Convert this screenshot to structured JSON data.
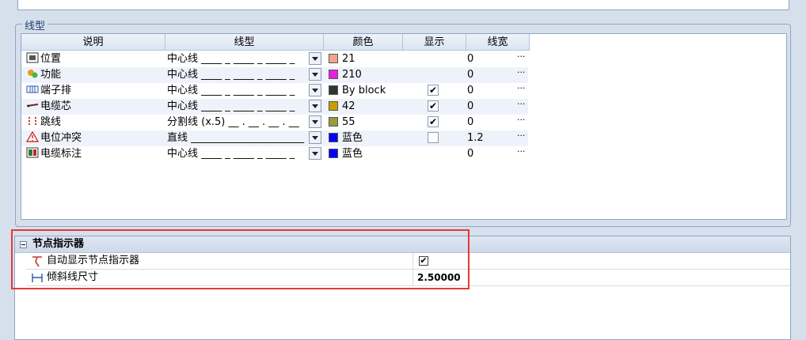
{
  "linetype_group": {
    "title": "线型",
    "columns": [
      "说明",
      "线型",
      "颜色",
      "显示",
      "线宽"
    ],
    "rows": [
      {
        "icon": "location-icon",
        "desc": "位置",
        "linetype": "中心线 ____ _ ____ _ ____ _",
        "color": "#f4a585",
        "color_label": "21",
        "show": null,
        "width": "0",
        "more": "···"
      },
      {
        "icon": "function-icon",
        "desc": "功能",
        "linetype": "中心线 ____ _ ____ _ ____ _",
        "color": "#e91ee3",
        "color_label": "210",
        "show": null,
        "width": "0",
        "more": "···"
      },
      {
        "icon": "terminal-strip-icon",
        "desc": "端子排",
        "linetype": "中心线 ____ _ ____ _ ____ _",
        "color": "#333333",
        "color_label": "By block",
        "show": true,
        "width": "0",
        "more": "···"
      },
      {
        "icon": "cable-core-icon",
        "desc": "电缆芯",
        "linetype": "中心线 ____ _ ____ _ ____ _",
        "color": "#c9a000",
        "color_label": "42",
        "show": true,
        "width": "0",
        "more": "···"
      },
      {
        "icon": "jumper-icon",
        "desc": "跳线",
        "linetype": "分割线 (x.5) __ . __ . __ . __",
        "color": "#9a9a40",
        "color_label": "55",
        "show": true,
        "width": "0",
        "more": "···"
      },
      {
        "icon": "potential-conflict-icon",
        "desc": "电位冲突",
        "linetype": "直线 ______________________",
        "color": "#0000ff",
        "color_label": "蓝色",
        "show": false,
        "width": "1.2",
        "more": "···"
      },
      {
        "icon": "cable-tag-icon",
        "desc": "电缆标注",
        "linetype": "中心线 ____ _ ____ _ ____ _",
        "color": "#0000ff",
        "color_label": "蓝色",
        "show": null,
        "width": "0",
        "more": "···"
      }
    ]
  },
  "node_indicator": {
    "title": "节点指示器",
    "props": [
      {
        "icon": "node-indicator-icon",
        "label": "自动显示节点指示器",
        "value": "",
        "checked": true
      },
      {
        "icon": "slant-line-size-icon",
        "label": "倾斜线尺寸",
        "value": "2.50000",
        "checked": null
      }
    ]
  }
}
